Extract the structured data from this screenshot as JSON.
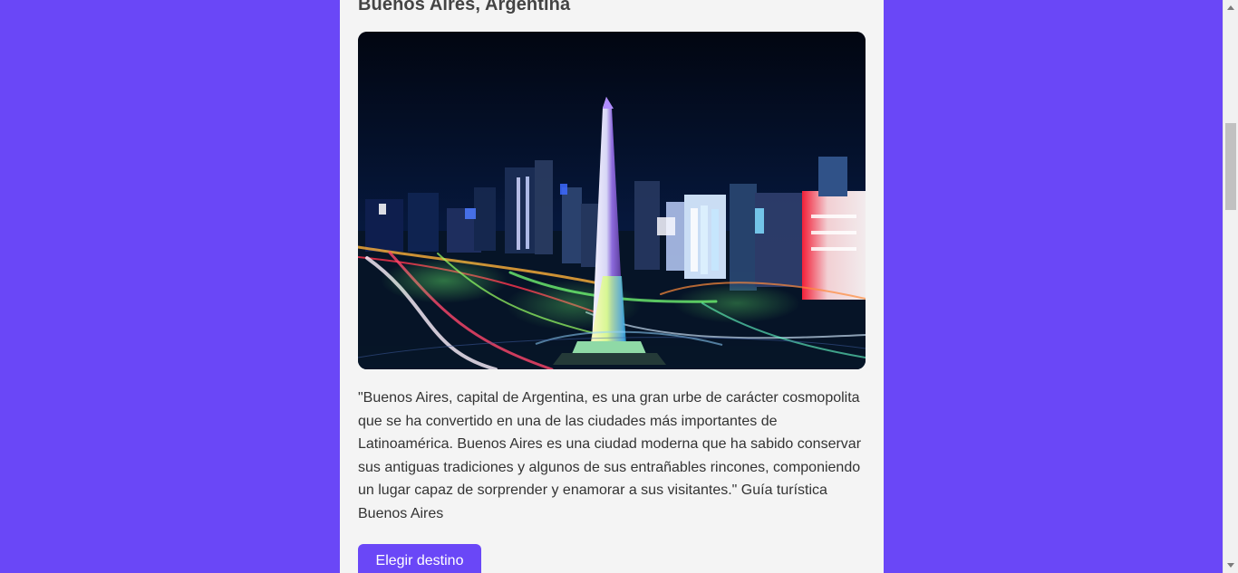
{
  "destination": {
    "title": "Buenos Aires, Argentina",
    "image_alt": "Buenos Aires obelisk at night",
    "description": "\"Buenos Aires, capital de Argentina, es una gran urbe de carácter cosmopolita que se ha convertido en una de las ciudades más importantes de Latinoamérica. Buenos Aires es una ciudad moderna que ha sabido conservar sus antiguas tradiciones y algunos de sus entrañables rincones, componiendo un lugar capaz de sorprender y enamorar a sus visitantes.\" Guía turística Buenos Aires",
    "button_label": "Elegir destino"
  },
  "colors": {
    "page_background": "#6a47f7",
    "card_background": "#f4f4f4",
    "button_background": "#6a47f7"
  },
  "scrollbar": {
    "up_icon": "chevron-up-icon",
    "down_icon": "chevron-down-icon"
  }
}
